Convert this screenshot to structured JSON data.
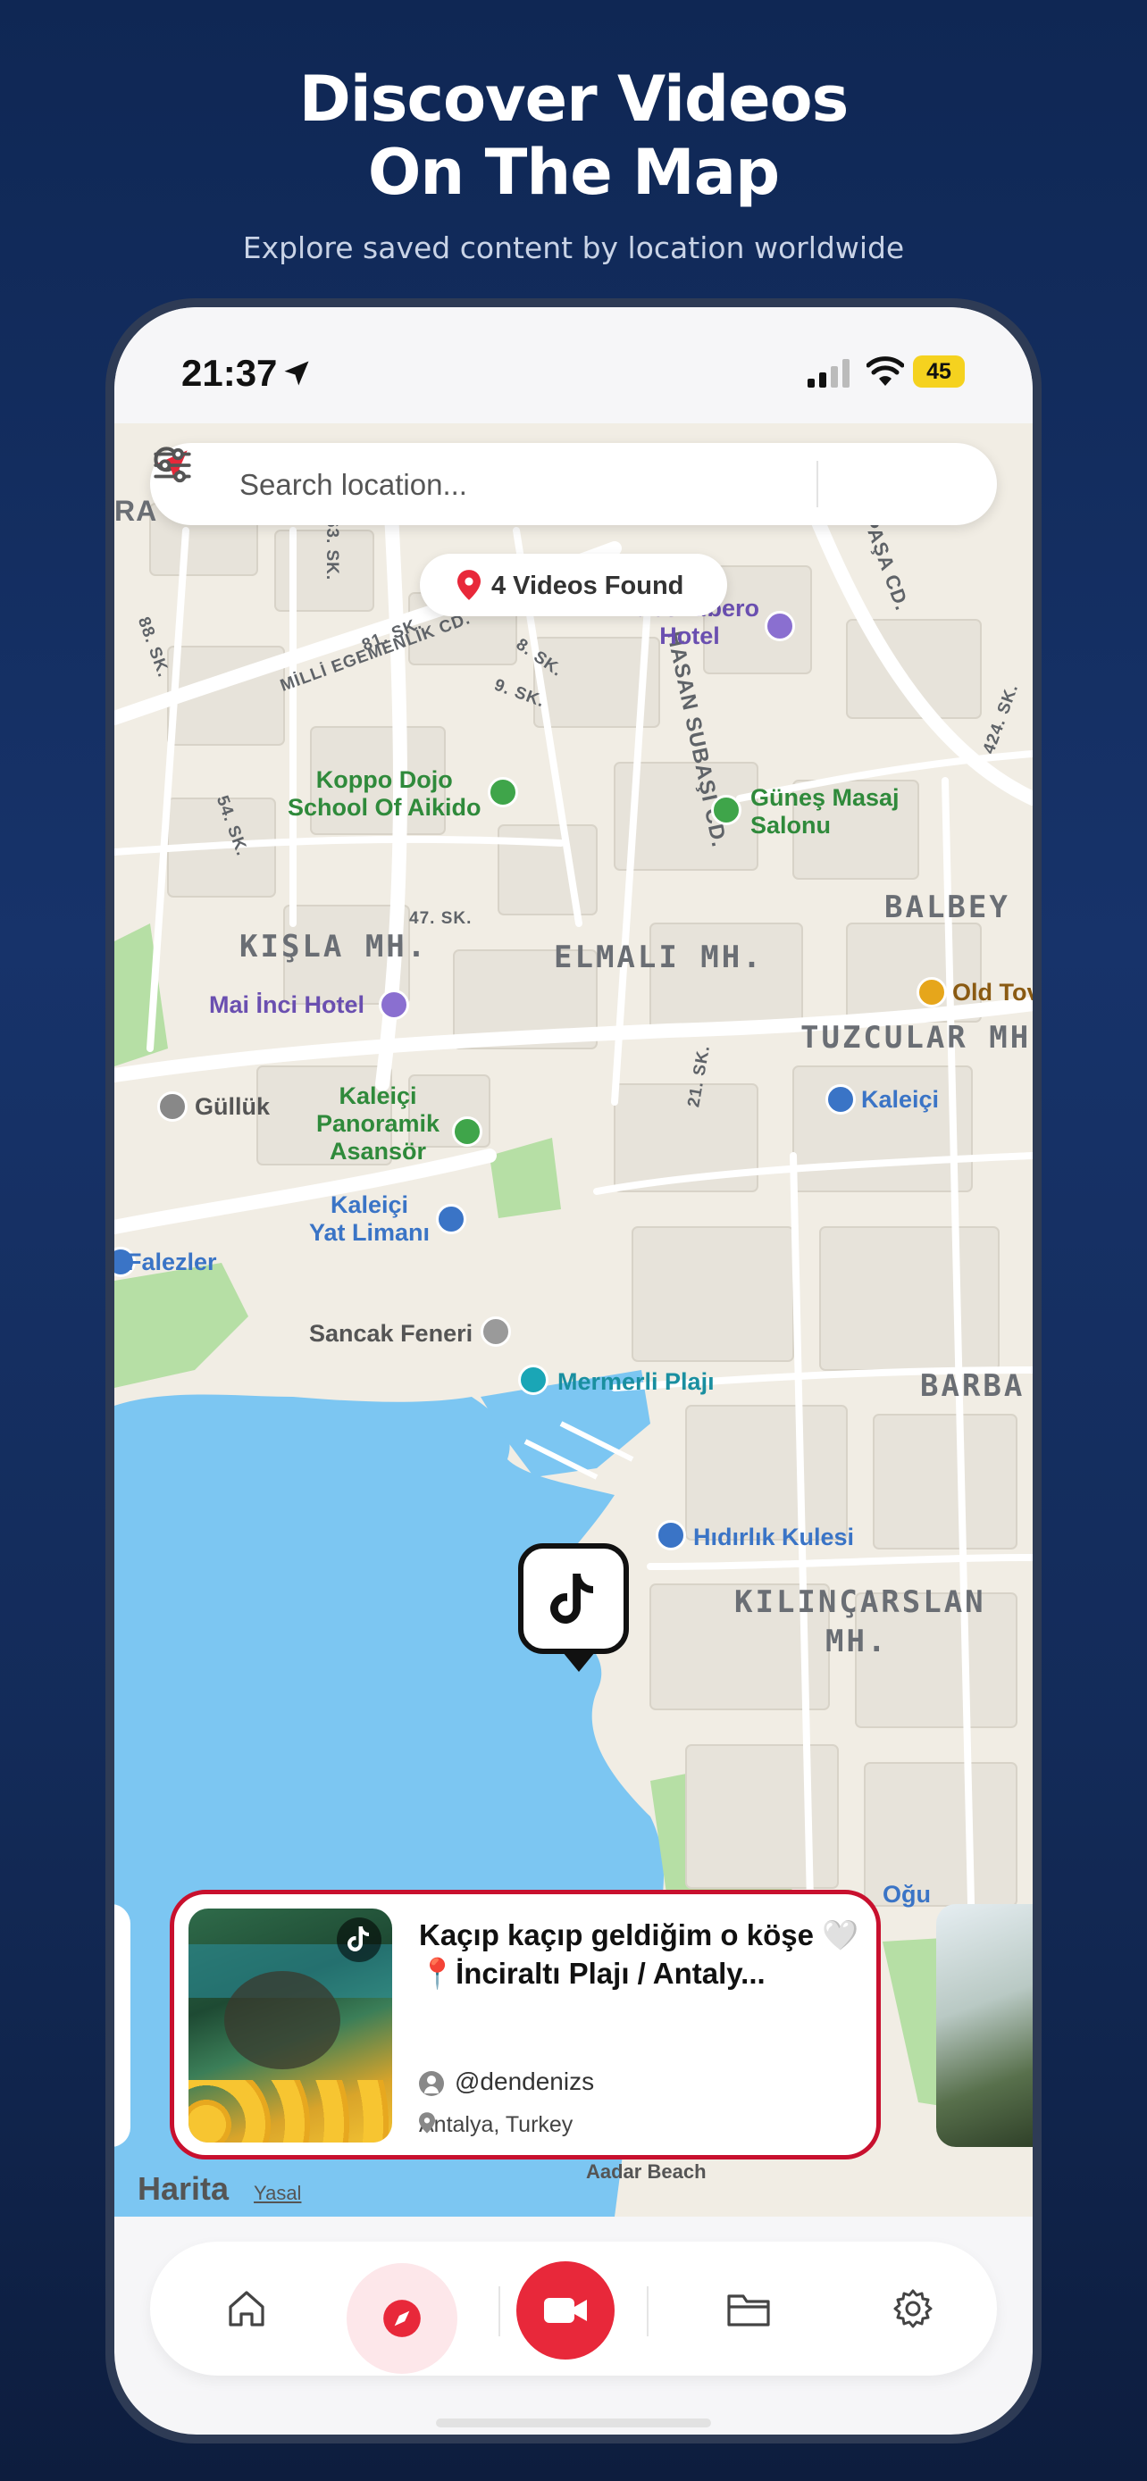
{
  "promo": {
    "title_line1": "Discover Videos",
    "title_line2": "On The Map",
    "subtitle": "Explore saved content by location worldwide"
  },
  "status_bar": {
    "time": "21:37",
    "battery": "45"
  },
  "search": {
    "placeholder": "Search location..."
  },
  "results": {
    "label": "4 Videos Found"
  },
  "map": {
    "districts": [
      "KIŞLA MH.",
      "ELMALI MH.",
      "TUZCULAR MH",
      "BALBEY",
      "BARBA",
      "KILINÇARSLAN",
      "MH."
    ],
    "pois": [
      "Lubo Libero",
      "Hotel",
      "Koppo Dojo",
      "School Of Aikido",
      "Güneş Masaj",
      "Salonu",
      "Mai İnci Hotel",
      "Old Tov",
      "Güllük",
      "Kaleiçi",
      "Panoramik",
      "Asansör",
      "Kaleiçi",
      "Kaleiçi",
      "Yat Limanı",
      "Falezler",
      "Sancak Feneri",
      "Mermerli Plajı",
      "Hıdırlık Kulesi",
      "Oğu",
      "Aadar Beach"
    ],
    "streets": [
      "MİLLİ EGEMENLİK CD.",
      "HASAN SUBAŞI CD.",
      "SMET PAŞA CD.",
      "81. SK.",
      "8. SK.",
      "9. SK.",
      "47. SK.",
      "54. SK.",
      "21. SK.",
      "63. SK.",
      "88. SK.",
      "424. SK.",
      "RA"
    ],
    "attribution_brand": "Harita",
    "attribution_legal": "Yasal"
  },
  "video_card": {
    "title": "Kaçıp kaçıp geldiğim o köşe 🤍📍İnciraltı Plajı / Antaly...",
    "username": "@dendenizs",
    "location": "Antalya, Turkey"
  },
  "colors": {
    "accent": "#e8283a",
    "card_border": "#c8102e",
    "water": "#7cc6f2",
    "park": "#b6dfa5"
  },
  "tabbar": {
    "items": [
      "home-icon",
      "compass-icon",
      "video-camera-icon",
      "folder-icon",
      "gear-icon"
    ],
    "selected": "compass-icon"
  }
}
